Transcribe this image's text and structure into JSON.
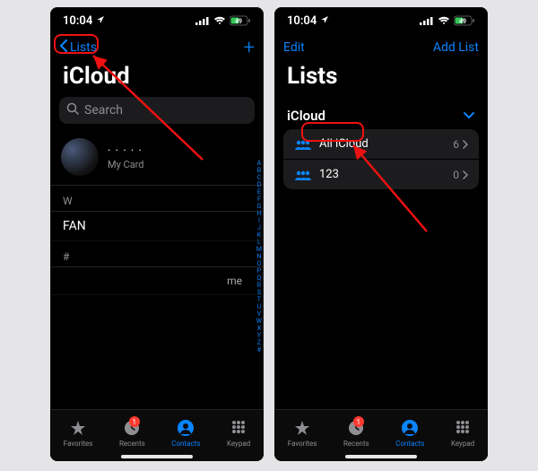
{
  "status": {
    "time": "10:04",
    "battery": "49",
    "signal": 4,
    "wifi": 3
  },
  "phone1": {
    "nav_back": "Lists",
    "title": "iCloud",
    "search_placeholder": "Search",
    "me": {
      "name": "· · · · ·",
      "sub": "My Card"
    },
    "section1": "W",
    "row1": "FAN",
    "section2": "#",
    "row2": "me",
    "index": [
      "A",
      "B",
      "C",
      "D",
      "E",
      "F",
      "G",
      "H",
      "I",
      "J",
      "K",
      "L",
      "M",
      "N",
      "O",
      "P",
      "Q",
      "R",
      "S",
      "T",
      "U",
      "V",
      "W",
      "X",
      "Y",
      "Z",
      "#"
    ]
  },
  "phone2": {
    "nav_left": "Edit",
    "nav_right": "Add List",
    "title": "Lists",
    "group_header": "iCloud",
    "rows": [
      {
        "label": "All iCloud",
        "count": "6"
      },
      {
        "label": "123",
        "count": "0"
      }
    ]
  },
  "tabs": {
    "favorites": "Favorites",
    "recents": "Recents",
    "recents_badge": "1",
    "contacts": "Contacts",
    "keypad": "Keypad"
  }
}
